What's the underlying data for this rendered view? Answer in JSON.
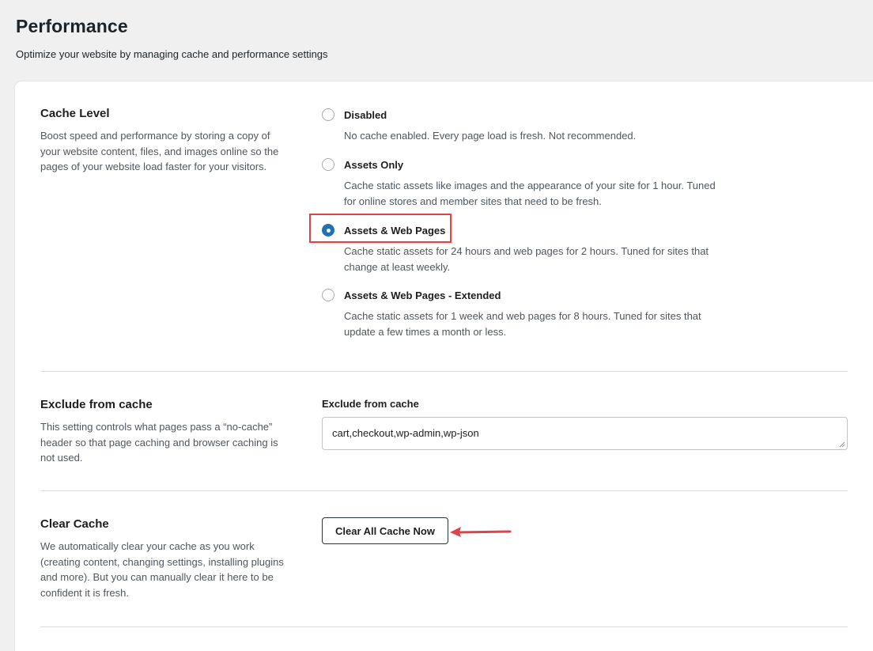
{
  "page": {
    "title": "Performance",
    "subtitle": "Optimize your website by managing cache and performance settings"
  },
  "cache_level": {
    "title": "Cache Level",
    "description": "Boost speed and performance by storing a copy of your website content, files, and images online so the pages of your website load faster for your visitors.",
    "selected": "Assets & Web Pages",
    "options": [
      {
        "label": "Disabled",
        "description": "No cache enabled. Every page load is fresh. Not recommended."
      },
      {
        "label": "Assets Only",
        "description": "Cache static assets like images and the appearance of your site for 1 hour. Tuned for online stores and member sites that need to be fresh."
      },
      {
        "label": "Assets & Web Pages",
        "description": "Cache static assets for 24 hours and web pages for 2 hours. Tuned for sites that change at least weekly."
      },
      {
        "label": "Assets & Web Pages - Extended",
        "description": "Cache static assets for 1 week and web pages for 8 hours. Tuned for sites that update a few times a month or less."
      }
    ]
  },
  "exclude": {
    "title": "Exclude from cache",
    "description": "This setting controls what pages pass a “no-cache” header so that page caching and browser caching is not used.",
    "field_label": "Exclude from cache",
    "value": "cart,checkout,wp-admin,wp-json"
  },
  "clear_cache": {
    "title": "Clear Cache",
    "description": "We automatically clear your cache as you work (creating content, changing settings, installing plugins and more). But you can manually clear it here to be confident it is fresh.",
    "button_label": "Clear All Cache Now"
  },
  "colors": {
    "accent": "#2271b1",
    "annotation": "#e0424a"
  }
}
